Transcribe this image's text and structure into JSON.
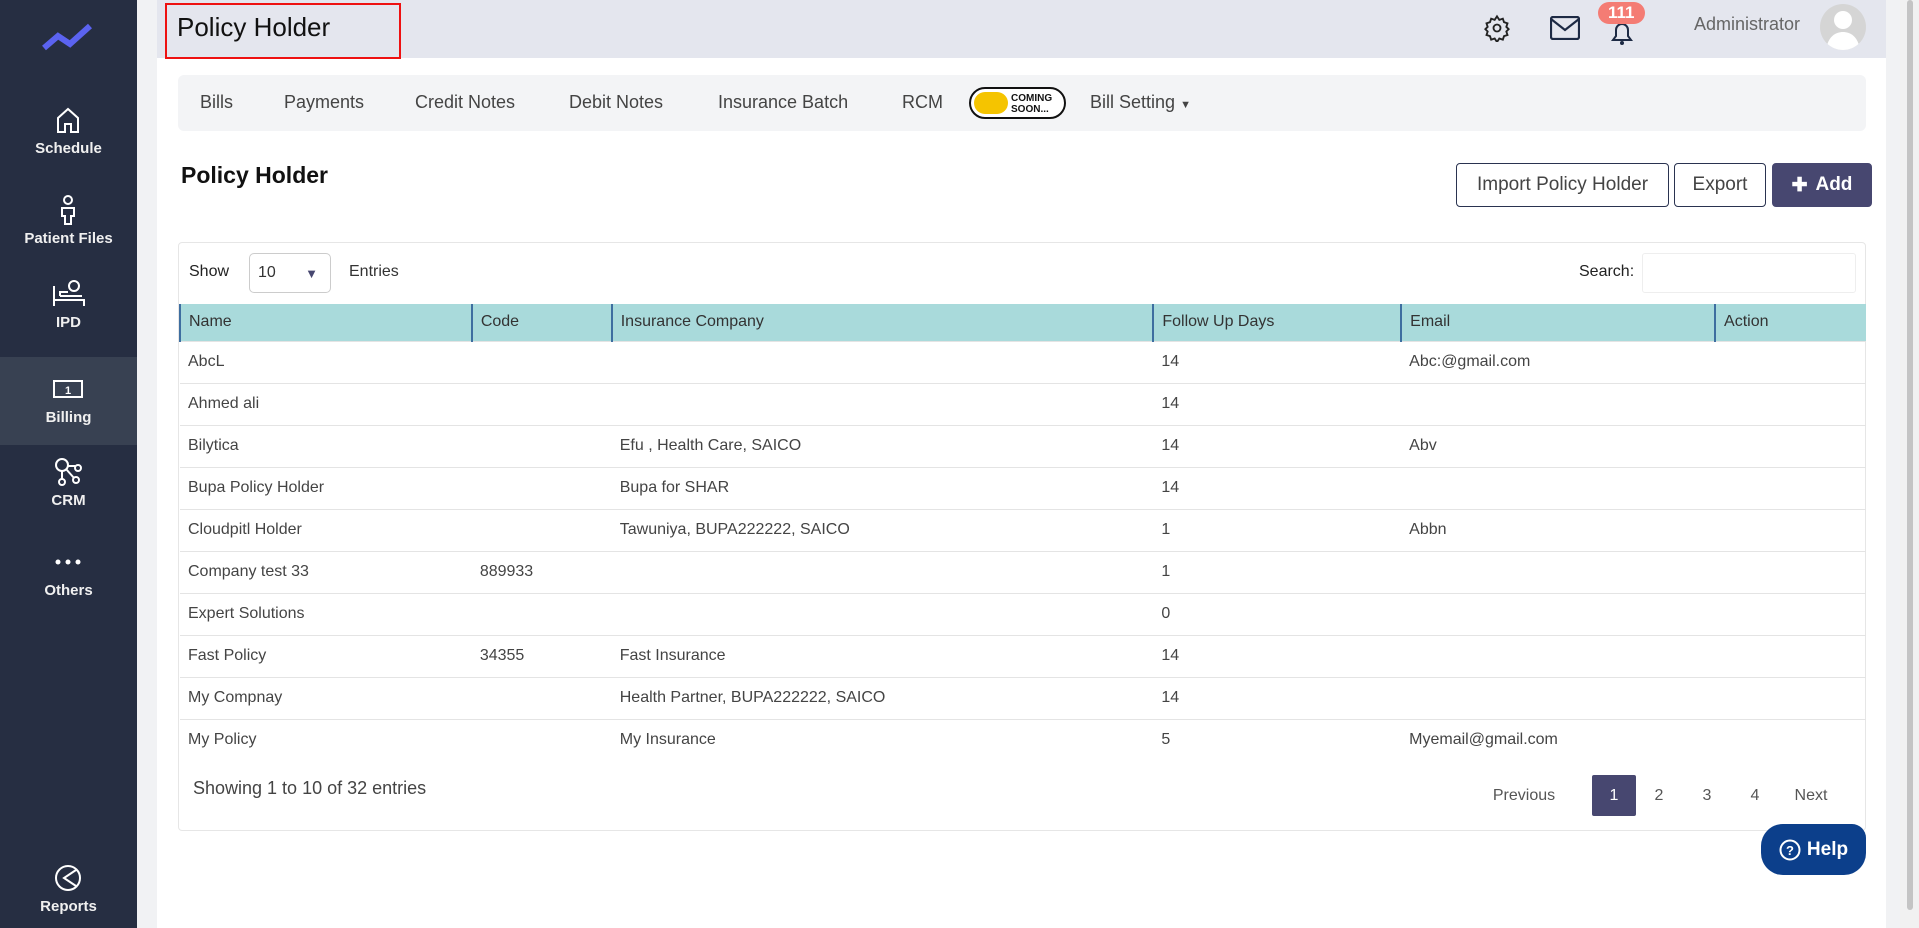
{
  "sidebar": {
    "items": [
      {
        "label": "Schedule"
      },
      {
        "label": "Patient Files"
      },
      {
        "label": "IPD"
      },
      {
        "label": "Billing"
      },
      {
        "label": "CRM"
      },
      {
        "label": "Others"
      },
      {
        "label": "Reports"
      }
    ]
  },
  "header": {
    "title": "Policy Holder",
    "notification_count": "111",
    "user": "Administrator"
  },
  "tabs": {
    "bills": "Bills",
    "payments": "Payments",
    "credit_notes": "Credit Notes",
    "debit_notes": "Debit Notes",
    "insurance_batch": "Insurance Batch",
    "rcm": "RCM",
    "coming_soon_1": "COMING",
    "coming_soon_2": "SOON...",
    "bill_setting": "Bill Setting"
  },
  "section": {
    "title": "Policy Holder",
    "import": "Import Policy Holder",
    "export": "Export",
    "add": "Add"
  },
  "table": {
    "show": "Show",
    "entries_value": "10",
    "entries": "Entries",
    "search": "Search:",
    "columns": [
      "Name",
      "Code",
      "Insurance Company",
      "Follow Up Days",
      "Email",
      "Action"
    ],
    "rows": [
      [
        "AbcL",
        "",
        "",
        "14",
        "Abc:@gmail.com",
        ""
      ],
      [
        "Ahmed ali",
        "",
        "",
        "14",
        "",
        ""
      ],
      [
        "Bilytica",
        "",
        "Efu , Health Care, SAICO",
        "14",
        "Abv",
        ""
      ],
      [
        "Bupa Policy Holder",
        "",
        "Bupa for SHAR",
        "14",
        "",
        ""
      ],
      [
        "Cloudpitl Holder",
        "",
        "Tawuniya, BUPA222222, SAICO",
        "1",
        "Abbn",
        ""
      ],
      [
        "Company test 33",
        "889933",
        "",
        "1",
        "",
        ""
      ],
      [
        "Expert Solutions",
        "",
        "",
        "0",
        "",
        ""
      ],
      [
        "Fast Policy",
        "34355",
        "Fast Insurance",
        "14",
        "",
        ""
      ],
      [
        "My Compnay",
        "",
        "Health Partner, BUPA222222, SAICO",
        "14",
        "",
        ""
      ],
      [
        "My Policy",
        "",
        "My Insurance",
        "5",
        "Myemail@gmail.com",
        ""
      ]
    ],
    "info": "Showing 1 to 10 of 32 entries",
    "pagination": {
      "previous": "Previous",
      "pages": [
        "1",
        "2",
        "3",
        "4"
      ],
      "next": "Next"
    }
  },
  "help": "Help"
}
